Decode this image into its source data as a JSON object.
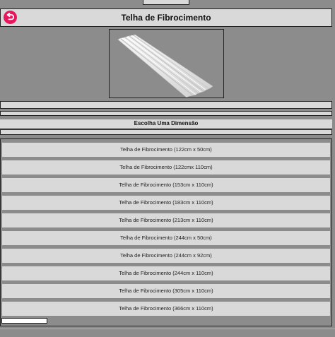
{
  "header": {
    "title": "Telha de Fibrocimento",
    "back_icon": "back-arrow-icon"
  },
  "product": {
    "image_subject": "corrugated fiber cement roof sheet"
  },
  "section": {
    "title": "Escolha Uma Dimensão"
  },
  "options": [
    {
      "label": "Telha de Fibrocimento (122cm x 50cm)"
    },
    {
      "label": "Telha de Fibrocimento (122cmx 110cm)"
    },
    {
      "label": "Telha de Fibrocimento (153cm x 110cm)"
    },
    {
      "label": "Telha de Fibrocimento (183cm x 110cm)"
    },
    {
      "label": "Telha de Fibrocimento (213cm x 110cm)"
    },
    {
      "label": "Telha de Fibrocimento (244cm x 50cm)"
    },
    {
      "label": "Telha de Fibrocimento (244cm x 92cm)"
    },
    {
      "label": "Telha de Fibrocimento (244cm x 110cm)"
    },
    {
      "label": "Telha de Fibrocimento (305cm x 110cm)"
    },
    {
      "label": "Telha de Fibrocimento (366cm x 110cm)"
    }
  ],
  "colors": {
    "background": "#8c8c8c",
    "panel": "#d9d9d9",
    "accent": "#e8175d"
  }
}
